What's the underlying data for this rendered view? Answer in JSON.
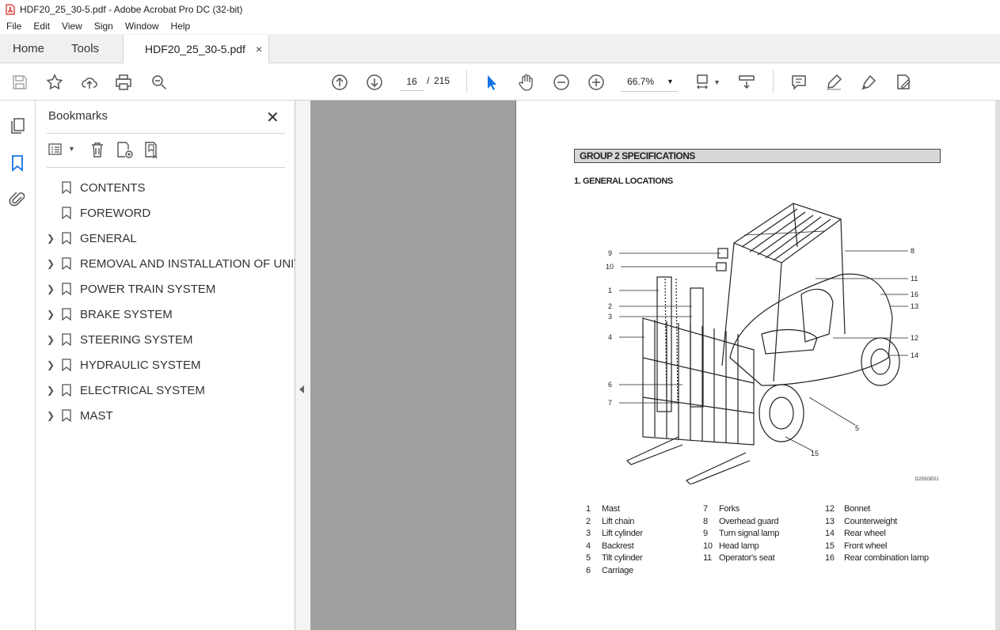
{
  "window": {
    "title": "HDF20_25_30-5.pdf - Adobe Acrobat Pro DC (32-bit)"
  },
  "menu": [
    "File",
    "Edit",
    "View",
    "Sign",
    "Window",
    "Help"
  ],
  "tabs": {
    "home": "Home",
    "tools": "Tools",
    "document": "HDF20_25_30-5.pdf",
    "close": "×"
  },
  "toolbar": {
    "current_page": "16",
    "separator": "/",
    "total_pages": "215",
    "zoom": "66.7%"
  },
  "bookmarks": {
    "title": "Bookmarks",
    "items": [
      {
        "label": "CONTENTS",
        "expandable": false
      },
      {
        "label": "FOREWORD",
        "expandable": false
      },
      {
        "label": "GENERAL",
        "expandable": true
      },
      {
        "label": "REMOVAL AND INSTALLATION OF UNIT",
        "expandable": true
      },
      {
        "label": "POWER TRAIN SYSTEM",
        "expandable": true
      },
      {
        "label": "BRAKE SYSTEM",
        "expandable": true
      },
      {
        "label": "STEERING SYSTEM",
        "expandable": true
      },
      {
        "label": "HYDRAULIC SYSTEM",
        "expandable": true
      },
      {
        "label": "ELECTRICAL SYSTEM",
        "expandable": true
      },
      {
        "label": "MAST",
        "expandable": true
      }
    ]
  },
  "document": {
    "group_header": "GROUP 2  SPECIFICATIONS",
    "section_title": "1. GENERAL LOCATIONS",
    "figure_code": "D255GE01",
    "callouts": [
      "9",
      "10",
      "1",
      "2",
      "3",
      "4",
      "6",
      "7",
      "8",
      "11",
      "16",
      "13",
      "12",
      "14",
      "5",
      "15"
    ],
    "legend": [
      [
        {
          "n": "1",
          "label": "Mast"
        },
        {
          "n": "2",
          "label": "Lift chain"
        },
        {
          "n": "3",
          "label": "Lift cylinder"
        },
        {
          "n": "4",
          "label": "Backrest"
        },
        {
          "n": "5",
          "label": "Tilt cylinder"
        },
        {
          "n": "6",
          "label": "Carriage"
        }
      ],
      [
        {
          "n": "7",
          "label": "Forks"
        },
        {
          "n": "8",
          "label": "Overhead guard"
        },
        {
          "n": "9",
          "label": "Turn signal lamp"
        },
        {
          "n": "10",
          "label": "Head lamp"
        },
        {
          "n": "11",
          "label": "Operator's seat"
        }
      ],
      [
        {
          "n": "12",
          "label": "Bonnet"
        },
        {
          "n": "13",
          "label": "Counterweight"
        },
        {
          "n": "14",
          "label": "Rear wheel"
        },
        {
          "n": "15",
          "label": "Front wheel"
        },
        {
          "n": "16",
          "label": "Rear combination lamp"
        }
      ]
    ]
  },
  "colors": {
    "accent": "#1473e6",
    "pdf_red": "#d9261c"
  }
}
